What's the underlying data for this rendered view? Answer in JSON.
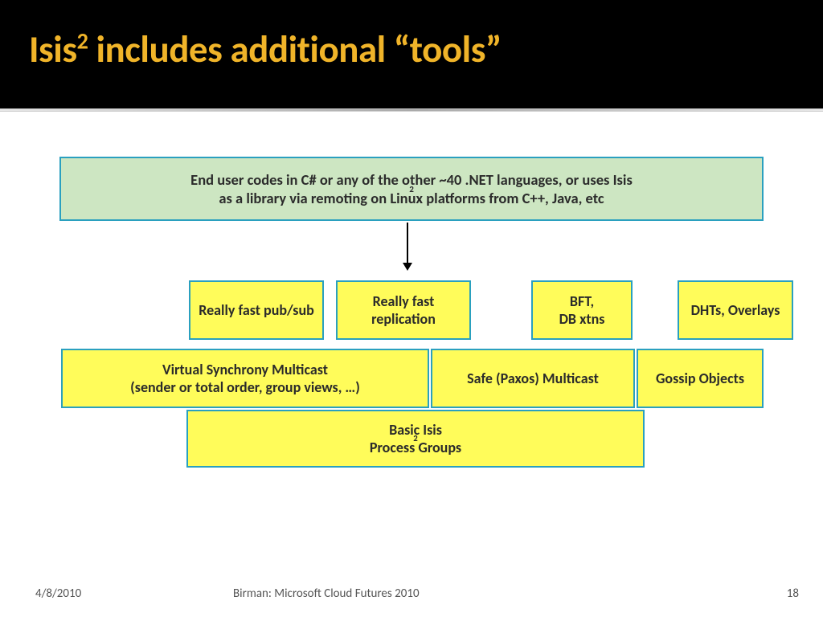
{
  "title_html": "Isis<sup>2</sup> includes additional “tools”",
  "top_box_html": "End user codes in C# or any of the other ~40 .NET languages, or uses Isis<sup class='small'>2</sup> as a library via remoting on Linux platforms from C++, Java, etc",
  "row1": {
    "b1": "Really fast pub/sub",
    "b2": "Really fast replication",
    "b3": "BFT,\nDB xtns",
    "b4": "DHTs, Overlays"
  },
  "row2": {
    "b1": "Virtual Synchrony Multicast\n(sender or total order, group views, …)",
    "b2": "Safe (Paxos) Multicast",
    "b3": "Gossip Objects"
  },
  "bottom_html": "Basic Isis<sup class='small'>2</sup> Process Groups",
  "footer": {
    "left": "4/8/2010",
    "center": "Birman: Microsoft Cloud Futures 2010",
    "right": "18"
  },
  "colors": {
    "title_fg": "#f0b429",
    "box_border": "#2aa0bf",
    "green_bg": "#cde6c2",
    "yellow_bg": "#fffc5a"
  }
}
